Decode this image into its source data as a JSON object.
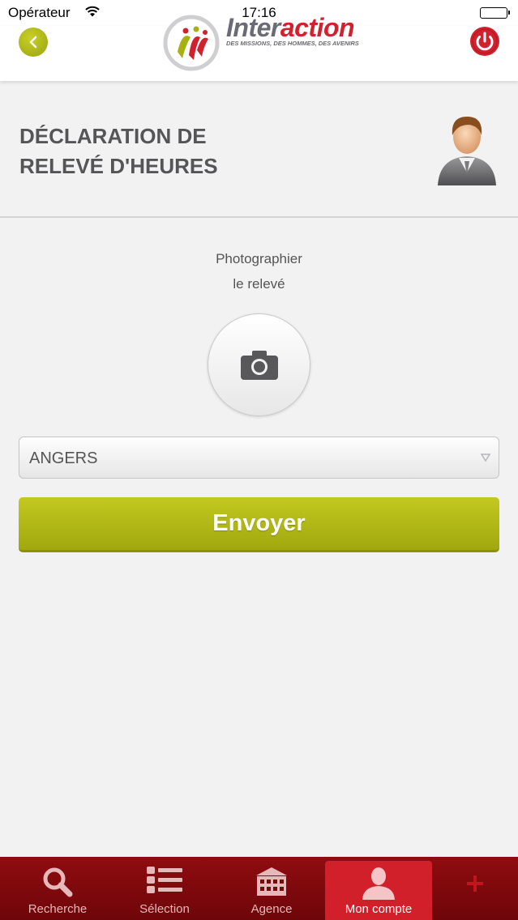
{
  "status_bar": {
    "carrier": "Opérateur",
    "time": "17:16"
  },
  "header": {
    "logo_text_part1": "Inter",
    "logo_text_part2": "action",
    "logo_tagline": "DES MISSIONS, DES HOMMES, DES AVENIRS",
    "accent_red": "#d1202e",
    "accent_green": "#a8b012"
  },
  "page": {
    "title": "DÉCLARATION DE RELEVÉ D'HEURES",
    "photo_label": "Photographier\nle relevé",
    "agency_select": {
      "value": "ANGERS"
    },
    "send_label": "Envoyer"
  },
  "tabbar": {
    "items": [
      {
        "label": "Recherche",
        "icon": "search-icon"
      },
      {
        "label": "Sélection",
        "icon": "list-icon"
      },
      {
        "label": "Agence",
        "icon": "building-icon"
      },
      {
        "label": "Mon compte",
        "icon": "user-icon",
        "active": true
      },
      {
        "label": "",
        "icon": "plus-icon"
      }
    ]
  }
}
